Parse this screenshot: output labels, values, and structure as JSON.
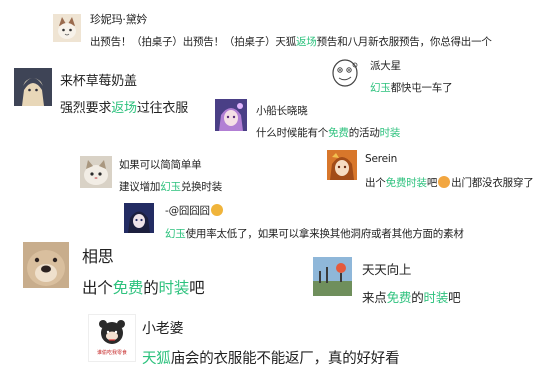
{
  "accent_color": "#2ec27e",
  "comments": [
    {
      "name": "珍妮玛·黛妗",
      "segments": [
        "出预告！（拍桌子）出预告！（拍桌子）天狐",
        "返场",
        "预告和八月新衣服预告，你总得出一个"
      ]
    },
    {
      "name": "来杯草莓奶盖",
      "segments": [
        "强烈要求",
        "返场",
        "过往衣服"
      ]
    },
    {
      "name": "派大星",
      "segments": [
        "幻玉",
        "都快屯一车了"
      ]
    },
    {
      "name": "小船长晓晓",
      "segments": [
        "什么时候能有个",
        "免费",
        "的活动",
        "时装"
      ]
    },
    {
      "name": "如果可以简简单单",
      "segments": [
        "建议增加",
        "幻玉",
        "兑换时装"
      ]
    },
    {
      "name": "Serein",
      "segments": [
        "出个",
        "免费",
        "时装",
        "吧",
        "出门都没衣服穿了"
      ]
    },
    {
      "name": "-@囧囧囧",
      "segments": [
        "幻玉",
        "使用率太低了，如果可以拿来换其他洞府或者其他方面的素材"
      ]
    },
    {
      "name": "相思",
      "segments": [
        "出个",
        "免费",
        "的",
        "时装",
        "吧"
      ]
    },
    {
      "name": "天天向上",
      "segments": [
        "来点",
        "免费",
        "的",
        "时装",
        "吧"
      ]
    },
    {
      "name": "小老婆",
      "segments": [
        "天狐",
        "庙会的衣服能不能返厂，真的好好看"
      ]
    }
  ],
  "avatar_text": {
    "xiaolaopo": "谁偷吃我零食"
  }
}
